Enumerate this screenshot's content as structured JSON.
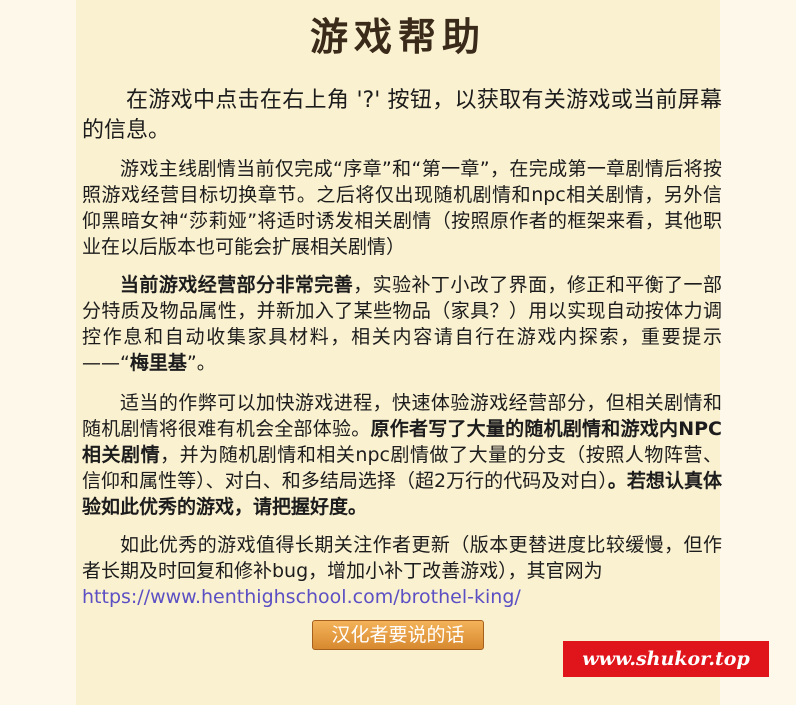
{
  "title": "游戏帮助",
  "intro": "在游戏中点击在右上角 '?' 按钮，以获取有关游戏或当前屏幕的信息。",
  "para1": "游戏主线剧情当前仅完成“序章”和“第一章”，在完成第一章剧情后将按照游戏经营目标切换章节。之后将仅出现随机剧情和npc相关剧情，另外信仰黑暗女神“莎莉娅”将适时诱发相关剧情（按照原作者的框架来看，其他职业在以后版本也可能会扩展相关剧情）",
  "para2": {
    "bold_lead": "当前游戏经营部分非常完善",
    "text": "，实验补丁小改了界面，修正和平衡了一部分特质及物品属性，并新加入了某些物品（家具？）用以实现自动按体力调控作息和自动收集家具材料，相关内容请自行在游戏内探索，重要提示——“",
    "bold_key": "梅里基",
    "tail": "”。"
  },
  "para3": {
    "text1": "适当的作弊可以加快游戏进程，快速体验游戏经营部分，但相关剧情和随机剧情将很难有机会全部体验。",
    "bold1": "原作者写了大量的随机剧情和游戏内NPC相关剧情",
    "text2": "，并为随机剧情和相关npc剧情做了大量的分支（按照人物阵营、信仰和属性等）、对白、和多结局选择（超2万行的代码及对白）",
    "bold2": "。若想认真体验如此优秀的游戏，请把握好度。"
  },
  "para4": "如此优秀的游戏值得长期关注作者更新（版本更替进度比较缓慢，但作者长期及时回复和修补bug，增加小补丁改善游戏），其官网为",
  "link": "https://www.henthighschool.com/brothel-king/",
  "button": "汉化者要说的话",
  "watermark": "www.shukor.top"
}
